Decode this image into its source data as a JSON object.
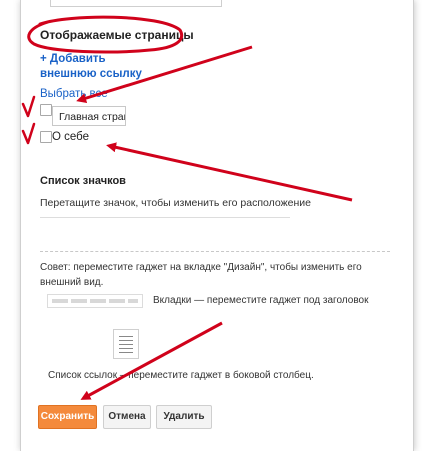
{
  "pages_section": {
    "title": "Отображаемые страницы",
    "add_link": "+ Добавить внешнюю ссылку",
    "select_all": "Выбрать все",
    "home_page_value": "Главная страница",
    "about_label": "О себе"
  },
  "icons_section": {
    "title": "Список значков",
    "drag_hint": "Перетащите значок, чтобы изменить его расположение"
  },
  "layout_advice": {
    "tip": "Совет: переместите гаджет на вкладке \"Дизайн\", чтобы изменить его внешний вид.",
    "tabs_label": "Вкладки — переместите гаджет под заголовок",
    "list_label": "Список ссылок – переместите гаджет в боковой столбец."
  },
  "buttons": {
    "save": "Сохранить",
    "cancel": "Отмена",
    "delete": "Удалить"
  },
  "colors": {
    "link": "#1a62c7",
    "save_button": "#f48a3c",
    "annotation": "#d0021b"
  }
}
